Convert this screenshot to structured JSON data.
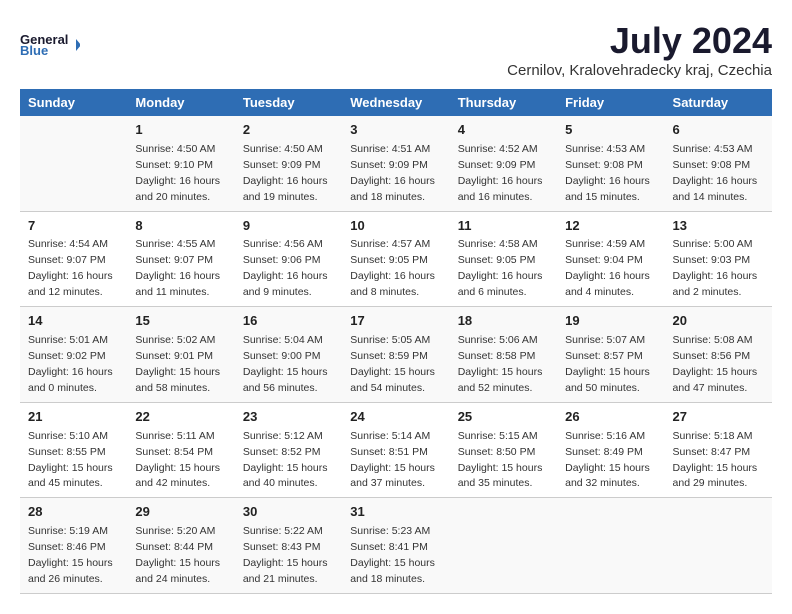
{
  "header": {
    "logo_line1": "General",
    "logo_line2": "Blue",
    "month": "July 2024",
    "location": "Cernilov, Kralovehradecky kraj, Czechia"
  },
  "days_of_week": [
    "Sunday",
    "Monday",
    "Tuesday",
    "Wednesday",
    "Thursday",
    "Friday",
    "Saturday"
  ],
  "weeks": [
    [
      {
        "day": "",
        "sunrise": "",
        "sunset": "",
        "daylight": ""
      },
      {
        "day": "1",
        "sunrise": "Sunrise: 4:50 AM",
        "sunset": "Sunset: 9:10 PM",
        "daylight": "Daylight: 16 hours and 20 minutes."
      },
      {
        "day": "2",
        "sunrise": "Sunrise: 4:50 AM",
        "sunset": "Sunset: 9:09 PM",
        "daylight": "Daylight: 16 hours and 19 minutes."
      },
      {
        "day": "3",
        "sunrise": "Sunrise: 4:51 AM",
        "sunset": "Sunset: 9:09 PM",
        "daylight": "Daylight: 16 hours and 18 minutes."
      },
      {
        "day": "4",
        "sunrise": "Sunrise: 4:52 AM",
        "sunset": "Sunset: 9:09 PM",
        "daylight": "Daylight: 16 hours and 16 minutes."
      },
      {
        "day": "5",
        "sunrise": "Sunrise: 4:53 AM",
        "sunset": "Sunset: 9:08 PM",
        "daylight": "Daylight: 16 hours and 15 minutes."
      },
      {
        "day": "6",
        "sunrise": "Sunrise: 4:53 AM",
        "sunset": "Sunset: 9:08 PM",
        "daylight": "Daylight: 16 hours and 14 minutes."
      }
    ],
    [
      {
        "day": "7",
        "sunrise": "Sunrise: 4:54 AM",
        "sunset": "Sunset: 9:07 PM",
        "daylight": "Daylight: 16 hours and 12 minutes."
      },
      {
        "day": "8",
        "sunrise": "Sunrise: 4:55 AM",
        "sunset": "Sunset: 9:07 PM",
        "daylight": "Daylight: 16 hours and 11 minutes."
      },
      {
        "day": "9",
        "sunrise": "Sunrise: 4:56 AM",
        "sunset": "Sunset: 9:06 PM",
        "daylight": "Daylight: 16 hours and 9 minutes."
      },
      {
        "day": "10",
        "sunrise": "Sunrise: 4:57 AM",
        "sunset": "Sunset: 9:05 PM",
        "daylight": "Daylight: 16 hours and 8 minutes."
      },
      {
        "day": "11",
        "sunrise": "Sunrise: 4:58 AM",
        "sunset": "Sunset: 9:05 PM",
        "daylight": "Daylight: 16 hours and 6 minutes."
      },
      {
        "day": "12",
        "sunrise": "Sunrise: 4:59 AM",
        "sunset": "Sunset: 9:04 PM",
        "daylight": "Daylight: 16 hours and 4 minutes."
      },
      {
        "day": "13",
        "sunrise": "Sunrise: 5:00 AM",
        "sunset": "Sunset: 9:03 PM",
        "daylight": "Daylight: 16 hours and 2 minutes."
      }
    ],
    [
      {
        "day": "14",
        "sunrise": "Sunrise: 5:01 AM",
        "sunset": "Sunset: 9:02 PM",
        "daylight": "Daylight: 16 hours and 0 minutes."
      },
      {
        "day": "15",
        "sunrise": "Sunrise: 5:02 AM",
        "sunset": "Sunset: 9:01 PM",
        "daylight": "Daylight: 15 hours and 58 minutes."
      },
      {
        "day": "16",
        "sunrise": "Sunrise: 5:04 AM",
        "sunset": "Sunset: 9:00 PM",
        "daylight": "Daylight: 15 hours and 56 minutes."
      },
      {
        "day": "17",
        "sunrise": "Sunrise: 5:05 AM",
        "sunset": "Sunset: 8:59 PM",
        "daylight": "Daylight: 15 hours and 54 minutes."
      },
      {
        "day": "18",
        "sunrise": "Sunrise: 5:06 AM",
        "sunset": "Sunset: 8:58 PM",
        "daylight": "Daylight: 15 hours and 52 minutes."
      },
      {
        "day": "19",
        "sunrise": "Sunrise: 5:07 AM",
        "sunset": "Sunset: 8:57 PM",
        "daylight": "Daylight: 15 hours and 50 minutes."
      },
      {
        "day": "20",
        "sunrise": "Sunrise: 5:08 AM",
        "sunset": "Sunset: 8:56 PM",
        "daylight": "Daylight: 15 hours and 47 minutes."
      }
    ],
    [
      {
        "day": "21",
        "sunrise": "Sunrise: 5:10 AM",
        "sunset": "Sunset: 8:55 PM",
        "daylight": "Daylight: 15 hours and 45 minutes."
      },
      {
        "day": "22",
        "sunrise": "Sunrise: 5:11 AM",
        "sunset": "Sunset: 8:54 PM",
        "daylight": "Daylight: 15 hours and 42 minutes."
      },
      {
        "day": "23",
        "sunrise": "Sunrise: 5:12 AM",
        "sunset": "Sunset: 8:52 PM",
        "daylight": "Daylight: 15 hours and 40 minutes."
      },
      {
        "day": "24",
        "sunrise": "Sunrise: 5:14 AM",
        "sunset": "Sunset: 8:51 PM",
        "daylight": "Daylight: 15 hours and 37 minutes."
      },
      {
        "day": "25",
        "sunrise": "Sunrise: 5:15 AM",
        "sunset": "Sunset: 8:50 PM",
        "daylight": "Daylight: 15 hours and 35 minutes."
      },
      {
        "day": "26",
        "sunrise": "Sunrise: 5:16 AM",
        "sunset": "Sunset: 8:49 PM",
        "daylight": "Daylight: 15 hours and 32 minutes."
      },
      {
        "day": "27",
        "sunrise": "Sunrise: 5:18 AM",
        "sunset": "Sunset: 8:47 PM",
        "daylight": "Daylight: 15 hours and 29 minutes."
      }
    ],
    [
      {
        "day": "28",
        "sunrise": "Sunrise: 5:19 AM",
        "sunset": "Sunset: 8:46 PM",
        "daylight": "Daylight: 15 hours and 26 minutes."
      },
      {
        "day": "29",
        "sunrise": "Sunrise: 5:20 AM",
        "sunset": "Sunset: 8:44 PM",
        "daylight": "Daylight: 15 hours and 24 minutes."
      },
      {
        "day": "30",
        "sunrise": "Sunrise: 5:22 AM",
        "sunset": "Sunset: 8:43 PM",
        "daylight": "Daylight: 15 hours and 21 minutes."
      },
      {
        "day": "31",
        "sunrise": "Sunrise: 5:23 AM",
        "sunset": "Sunset: 8:41 PM",
        "daylight": "Daylight: 15 hours and 18 minutes."
      },
      {
        "day": "",
        "sunrise": "",
        "sunset": "",
        "daylight": ""
      },
      {
        "day": "",
        "sunrise": "",
        "sunset": "",
        "daylight": ""
      },
      {
        "day": "",
        "sunrise": "",
        "sunset": "",
        "daylight": ""
      }
    ]
  ]
}
